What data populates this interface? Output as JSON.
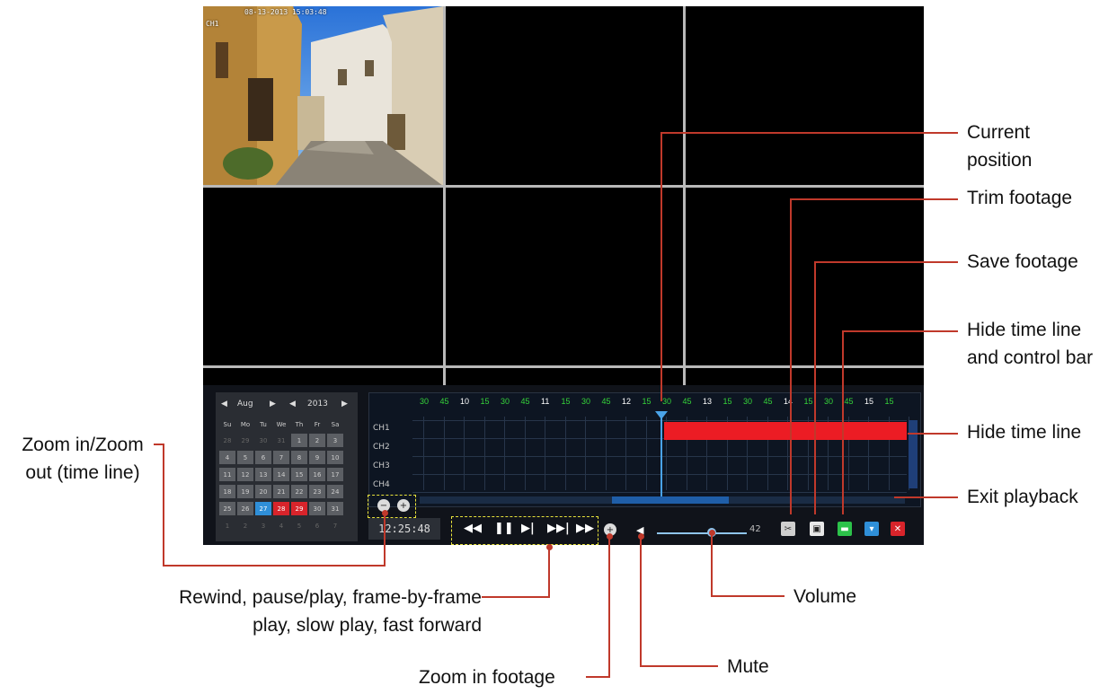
{
  "osd": {
    "timestamp": "08-13-2013 15:03:48",
    "channel": "CH1"
  },
  "calendar": {
    "month": "Aug",
    "year": "2013",
    "dow": [
      "Su",
      "Mo",
      "Tu",
      "We",
      "Th",
      "Fr",
      "Sa"
    ],
    "weeks": [
      [
        "28",
        "29",
        "30",
        "31",
        "1",
        "2",
        "3"
      ],
      [
        "4",
        "5",
        "6",
        "7",
        "8",
        "9",
        "10"
      ],
      [
        "11",
        "12",
        "13",
        "14",
        "15",
        "16",
        "17"
      ],
      [
        "18",
        "19",
        "20",
        "21",
        "22",
        "23",
        "24"
      ],
      [
        "25",
        "26",
        "27",
        "28",
        "29",
        "30",
        "31"
      ],
      [
        "1",
        "2",
        "3",
        "4",
        "5",
        "6",
        "7"
      ]
    ],
    "highlight_blue": "27",
    "highlight_red": [
      "28",
      "29"
    ]
  },
  "timeline": {
    "ticks": [
      {
        "t": "30",
        "c": "green"
      },
      {
        "t": "45",
        "c": "green"
      },
      {
        "t": "10",
        "c": "white"
      },
      {
        "t": "15",
        "c": "green"
      },
      {
        "t": "30",
        "c": "green"
      },
      {
        "t": "45",
        "c": "green"
      },
      {
        "t": "11",
        "c": "white"
      },
      {
        "t": "15",
        "c": "green"
      },
      {
        "t": "30",
        "c": "green"
      },
      {
        "t": "45",
        "c": "green"
      },
      {
        "t": "12",
        "c": "white"
      },
      {
        "t": "15",
        "c": "green"
      },
      {
        "t": "30",
        "c": "green"
      },
      {
        "t": "45",
        "c": "green"
      },
      {
        "t": "13",
        "c": "white"
      },
      {
        "t": "15",
        "c": "green"
      },
      {
        "t": "30",
        "c": "green"
      },
      {
        "t": "45",
        "c": "green"
      },
      {
        "t": "14",
        "c": "white"
      },
      {
        "t": "15",
        "c": "green"
      },
      {
        "t": "30",
        "c": "green"
      },
      {
        "t": "45",
        "c": "green"
      },
      {
        "t": "15",
        "c": "white"
      },
      {
        "t": "15",
        "c": "green"
      }
    ],
    "channels": [
      "CH1",
      "CH2",
      "CH3",
      "CH4"
    ]
  },
  "controls": {
    "current_time": "12:25:48",
    "volume": 42
  },
  "colors": {
    "accent": "#c0392b",
    "record": "#ec1c24",
    "tick_green": "#36d43a",
    "cursor": "#4aa3e8"
  },
  "callouts": {
    "current_position_1": "Current",
    "current_position_2": "position",
    "trim": "Trim footage",
    "save": "Save footage",
    "hide_both_1": "Hide time line",
    "hide_both_2": "and control bar",
    "hide_timeline": "Hide time line",
    "exit": "Exit playback",
    "zoom_timeline_1": "Zoom in/Zoom",
    "zoom_timeline_2": "out (time line)",
    "playback_1": "Rewind, pause/play, frame-by-frame",
    "playback_2": "play, slow play,  fast forward",
    "volume": "Volume",
    "zoom_footage": "Zoom in footage",
    "mute": "Mute"
  }
}
